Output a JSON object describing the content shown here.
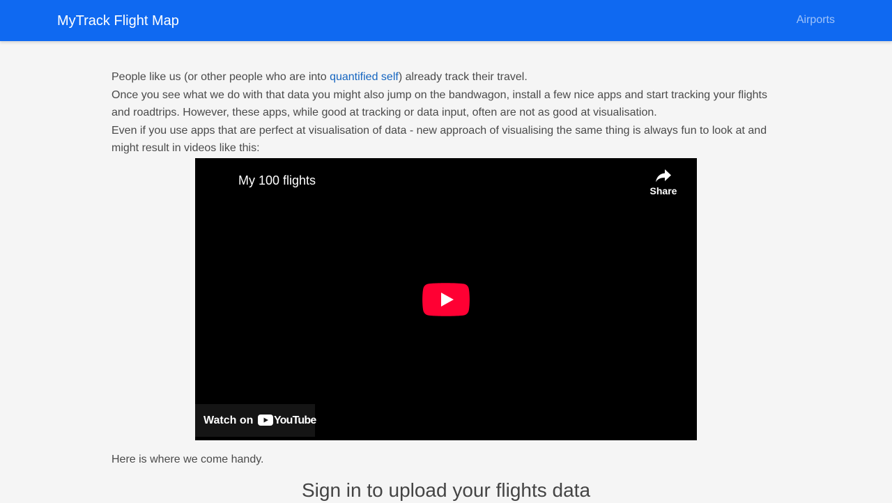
{
  "navbar": {
    "brand": "MyTrack Flight Map",
    "links": [
      "Airports"
    ],
    "background": "#0f69f1"
  },
  "intro": {
    "line1_before": "People like us (or other people who are into ",
    "line1_link": "quantified self",
    "line1_after": ") already track their travel.",
    "line2": "Once you see what we do with that data you might also jump on the bandwagon, install a few nice apps and start tracking your flights and roadtrips. However, these apps, while good at tracking or data input, often are not as good at visualisation.",
    "line3": "Even if you use apps that are perfect at visualisation of data - new approach of visualising the same thing is always fun to look at and might result in videos like this:"
  },
  "video": {
    "title": "My 100 flights",
    "share_label": "Share",
    "watch_on": "Watch on",
    "youtube_word": "YouTube",
    "play_color": "#ff0033"
  },
  "handy": "Here is where we come handy.",
  "signin": {
    "title": "Sign in to upload your flights data"
  }
}
